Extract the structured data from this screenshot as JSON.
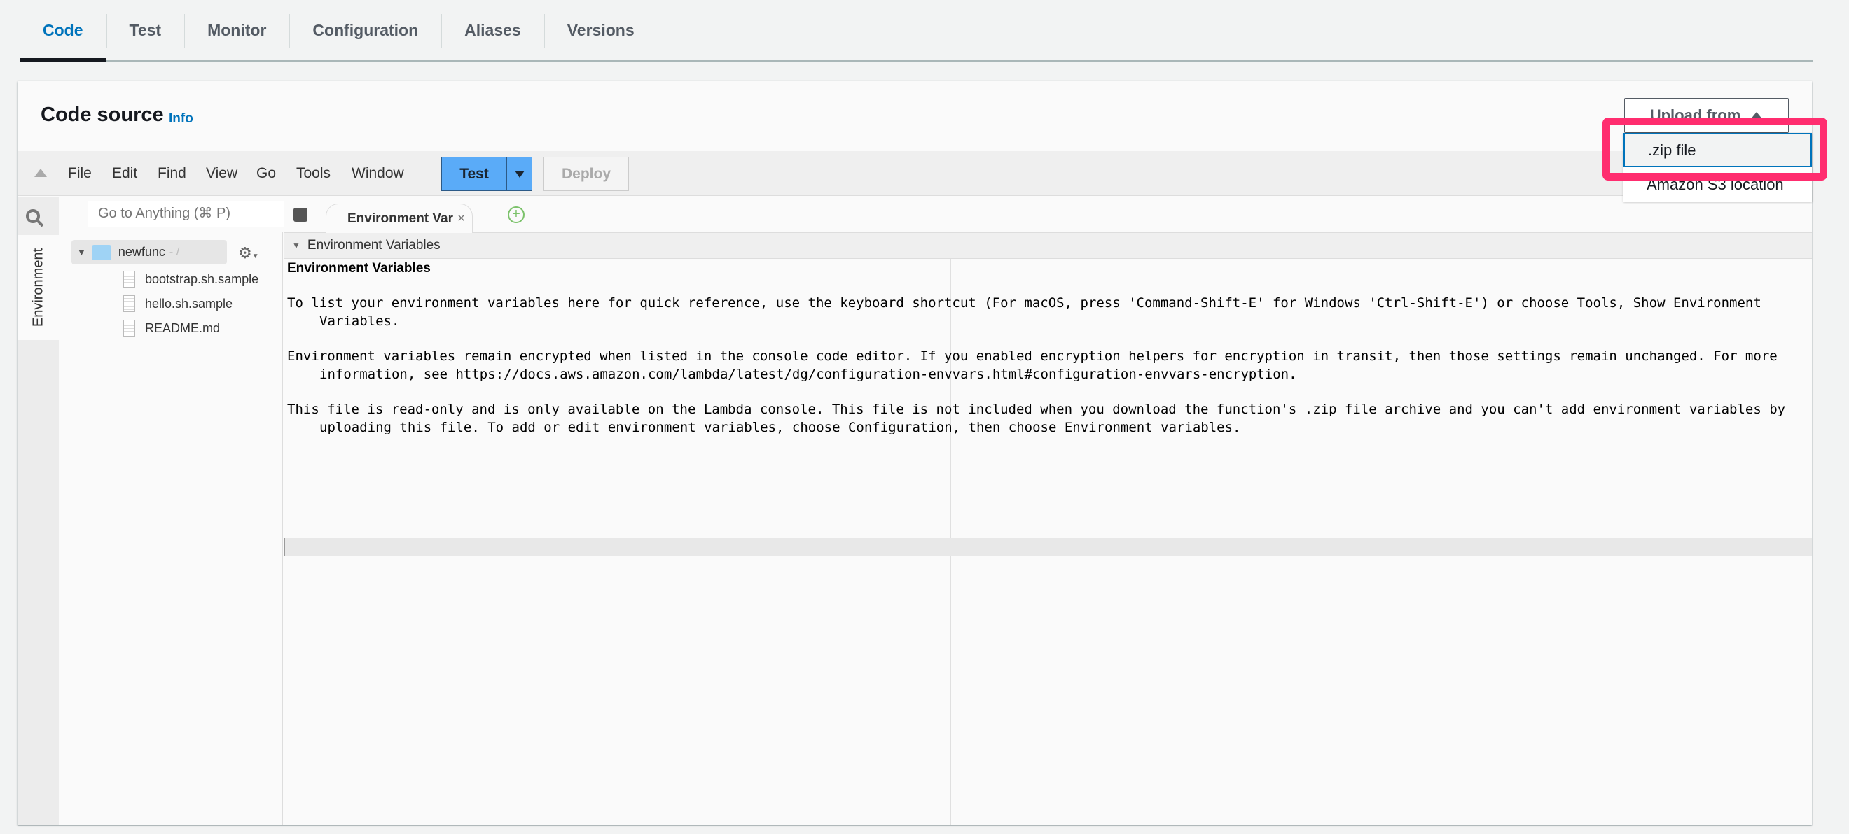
{
  "tabs": [
    "Code",
    "Test",
    "Monitor",
    "Configuration",
    "Aliases",
    "Versions"
  ],
  "active_tab": "Code",
  "section": {
    "title": "Code source",
    "info": "Info"
  },
  "upload": {
    "label": "Upload from",
    "options": [
      ".zip file",
      "Amazon S3 location"
    ],
    "highlighted": ".zip file"
  },
  "menu": [
    "File",
    "Edit",
    "Find",
    "View",
    "Go",
    "Tools",
    "Window"
  ],
  "toolbar": {
    "test": "Test",
    "deploy": "Deploy"
  },
  "search": {
    "placeholder": "Go to Anything (⌘ P)"
  },
  "sidebar": {
    "env_tab": "Environment"
  },
  "tree": {
    "root": "newfunc",
    "root_suffix": "- /",
    "files": [
      "bootstrap.sh.sample",
      "hello.sh.sample",
      "README.md"
    ]
  },
  "editor": {
    "tab": "Environment Var",
    "section": "Environment Variables",
    "heading": "Environment Variables",
    "paragraphs": [
      "To list your environment variables here for quick reference, use the keyboard shortcut (For macOS, press 'Command-Shift-E' for Windows 'Ctrl-Shift-E') or choose Tools, Show Environment Variables.",
      "Environment variables remain encrypted when listed in the console code editor. If you enabled encryption helpers for encryption in transit, then those settings remain unchanged. For more information, see https://docs.aws.amazon.com/lambda/latest/dg/configuration-envvars.html#configuration-envvars-encryption.",
      "This file is read-only and is only available on the Lambda console. This file is not included when you download the function's .zip file archive and you can't add environment variables by uploading this file. To add or edit environment variables, choose Configuration, then choose Environment variables."
    ]
  },
  "colors": {
    "accent": "#0073bb",
    "test_button": "#5aabf8",
    "highlight": "#ff2d6f"
  }
}
